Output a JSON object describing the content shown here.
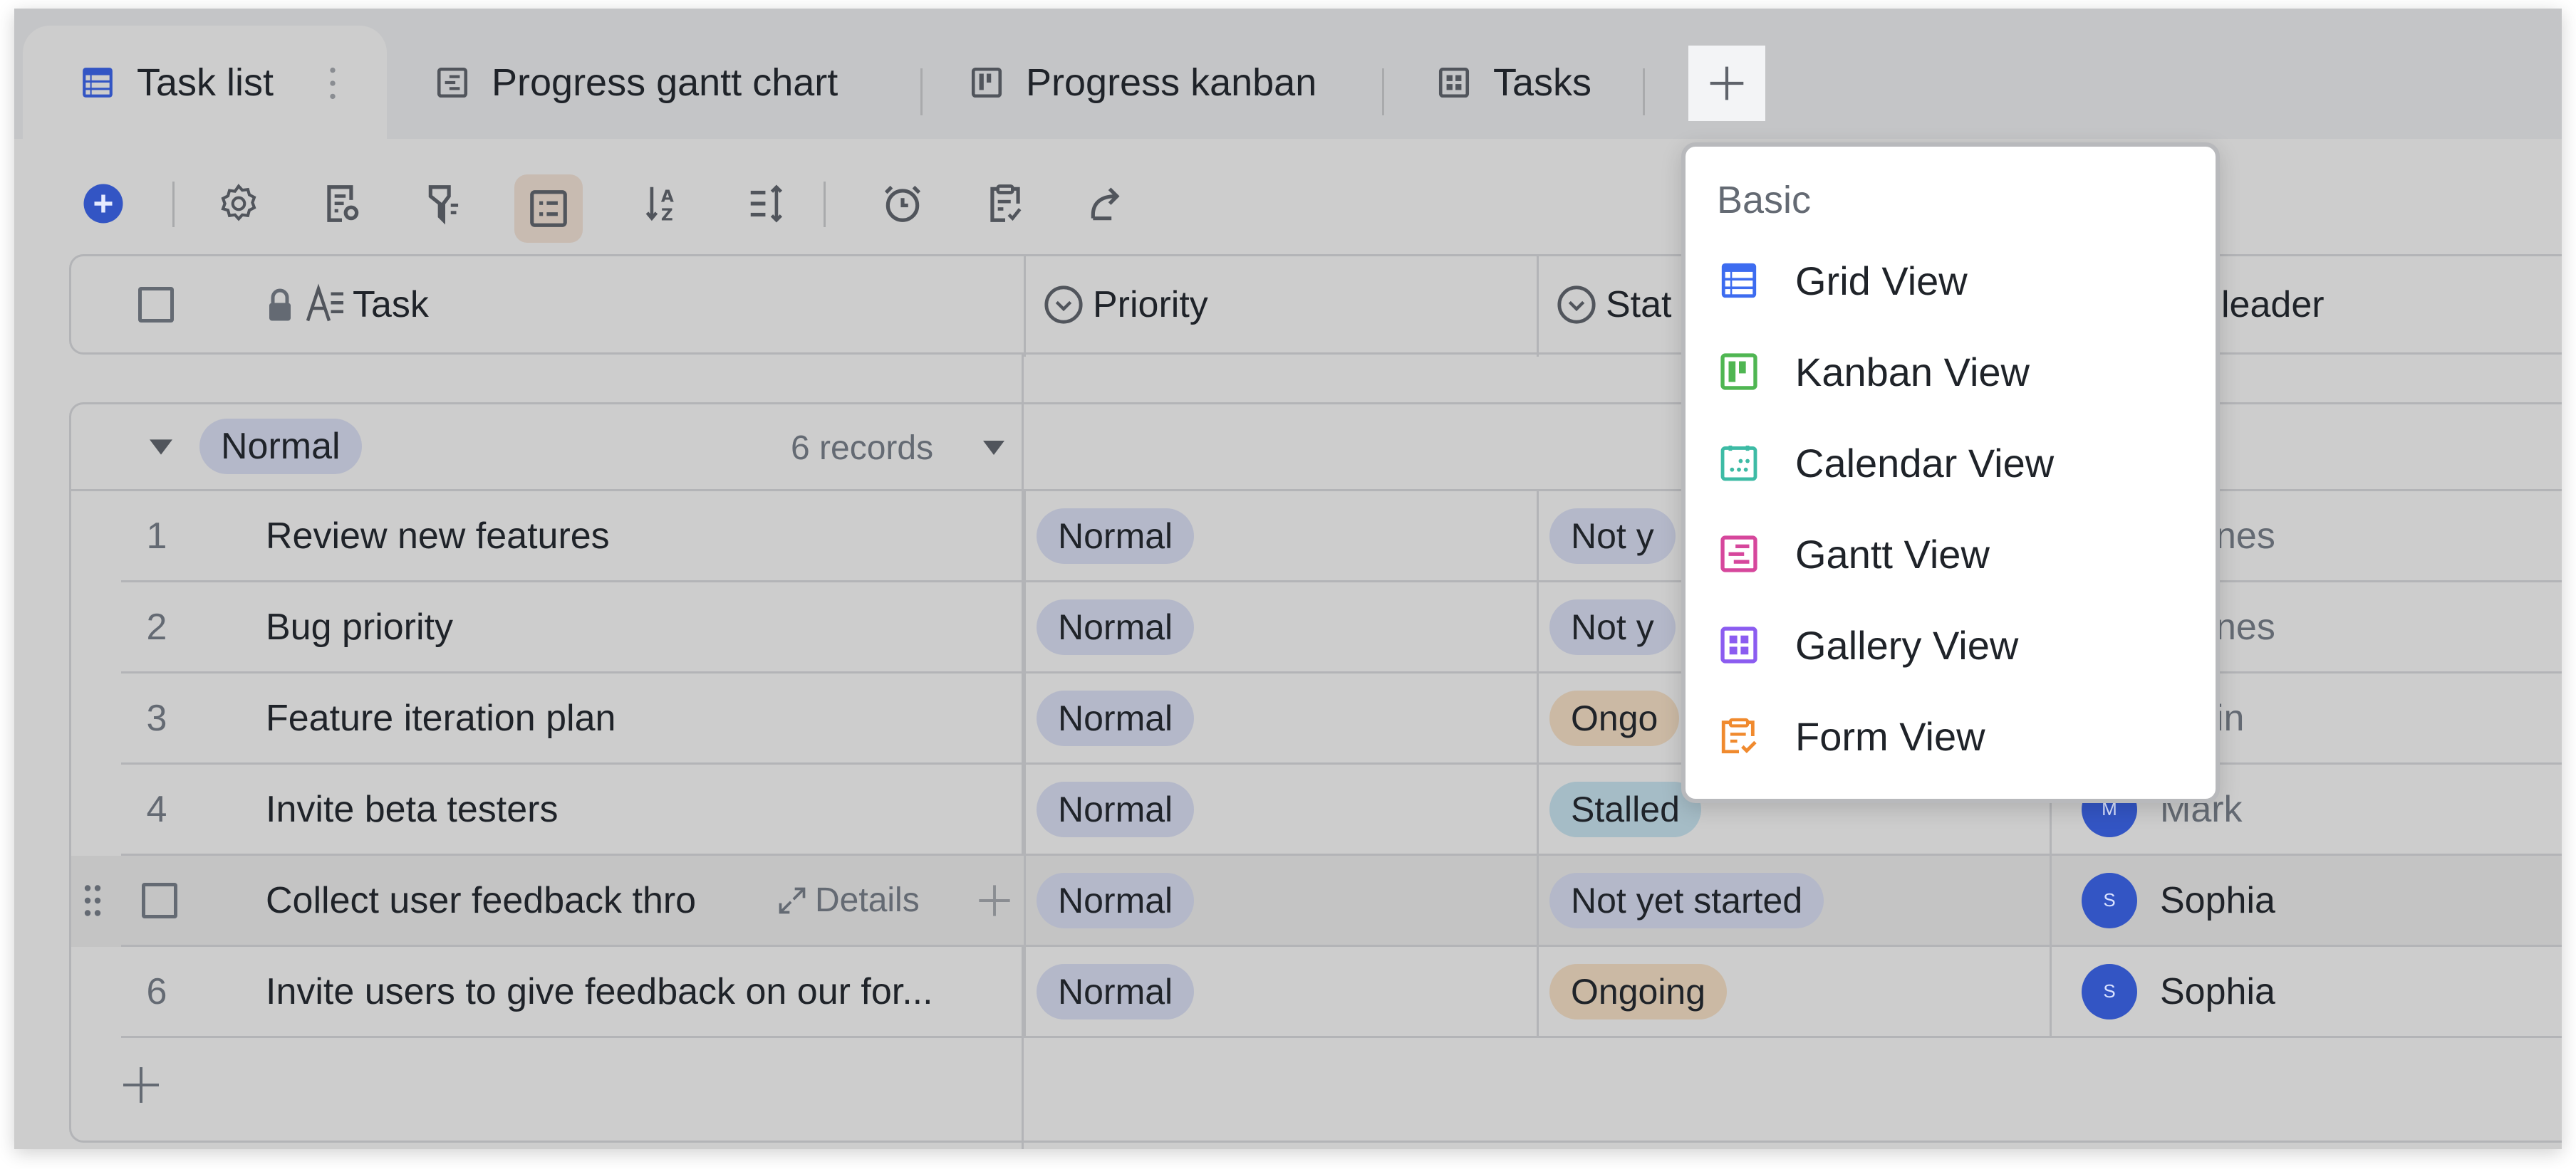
{
  "tabs": [
    {
      "label": "Task list",
      "icon": "grid-view-icon",
      "active": true
    },
    {
      "label": "Progress gantt chart",
      "icon": "gantt-view-icon",
      "active": false
    },
    {
      "label": "Progress kanban",
      "icon": "kanban-view-icon",
      "active": false
    },
    {
      "label": "Tasks",
      "icon": "gallery-view-icon",
      "active": false
    }
  ],
  "add_view_icon": "plus-icon",
  "toolbar": [
    {
      "name": "add-record",
      "icon": "plus-circle-icon"
    },
    {
      "name": "view-settings",
      "icon": "gear-icon"
    },
    {
      "name": "field-settings",
      "icon": "field-config-icon"
    },
    {
      "name": "filter",
      "icon": "filter-icon"
    },
    {
      "name": "group",
      "icon": "group-list-icon",
      "selected": true
    },
    {
      "name": "sort",
      "icon": "sort-az-icon"
    },
    {
      "name": "row-height",
      "icon": "row-height-icon"
    },
    {
      "name": "reminder",
      "icon": "alarm-clock-icon"
    },
    {
      "name": "form",
      "icon": "clipboard-check-icon"
    },
    {
      "name": "share",
      "icon": "share-arrow-icon"
    }
  ],
  "columns": {
    "task": "Task",
    "priority": "Priority",
    "status": "Stat",
    "leader": "leader"
  },
  "group": {
    "label": "Normal",
    "count": "6 records"
  },
  "rows": [
    {
      "num": "1",
      "task": "Review new features",
      "priority": "Normal",
      "status": "Not y",
      "status_type": "not-started",
      "leader": "nes",
      "avatar": ""
    },
    {
      "num": "2",
      "task": "Bug priority",
      "priority": "Normal",
      "status": "Not y",
      "status_type": "not-started",
      "leader": "nes",
      "avatar": ""
    },
    {
      "num": "3",
      "task": "Feature iteration plan",
      "priority": "Normal",
      "status": "Ongo",
      "status_type": "ongoing",
      "leader": "in",
      "avatar": ""
    },
    {
      "num": "4",
      "task": "Invite beta testers",
      "priority": "Normal",
      "status": "Stalled",
      "status_type": "stalled",
      "leader": "Mark",
      "avatar": "M"
    },
    {
      "num": "",
      "task": "Collect user feedback thro",
      "priority": "Normal",
      "status": "Not yet started",
      "status_type": "not-started",
      "leader": "Sophia",
      "avatar": "S",
      "hover": true,
      "details_label": "Details"
    },
    {
      "num": "6",
      "task": "Invite users to give feedback on our for...",
      "priority": "Normal",
      "status": "Ongoing",
      "status_type": "ongoing",
      "leader": "Sophia",
      "avatar": "S"
    }
  ],
  "colors": {
    "accent": "#3355c4",
    "pill_normal": "#b4b8c9",
    "pill_not_started": "#b4b8c9",
    "pill_ongoing": "#cbb9a4",
    "pill_stalled": "#a5bcc6"
  },
  "dropdown": {
    "title": "Basic",
    "items": [
      {
        "label": "Grid View",
        "icon": "grid-view-icon",
        "color": "#3d6cf0"
      },
      {
        "label": "Kanban View",
        "icon": "kanban-view-icon",
        "color": "#4fb652"
      },
      {
        "label": "Calendar View",
        "icon": "calendar-view-icon",
        "color": "#3dbba5"
      },
      {
        "label": "Gantt View",
        "icon": "gantt-view-icon",
        "color": "#d6479c"
      },
      {
        "label": "Gallery View",
        "icon": "gallery-view-icon",
        "color": "#8b5cf0"
      },
      {
        "label": "Form View",
        "icon": "form-view-icon",
        "color": "#f08a2e"
      }
    ]
  }
}
